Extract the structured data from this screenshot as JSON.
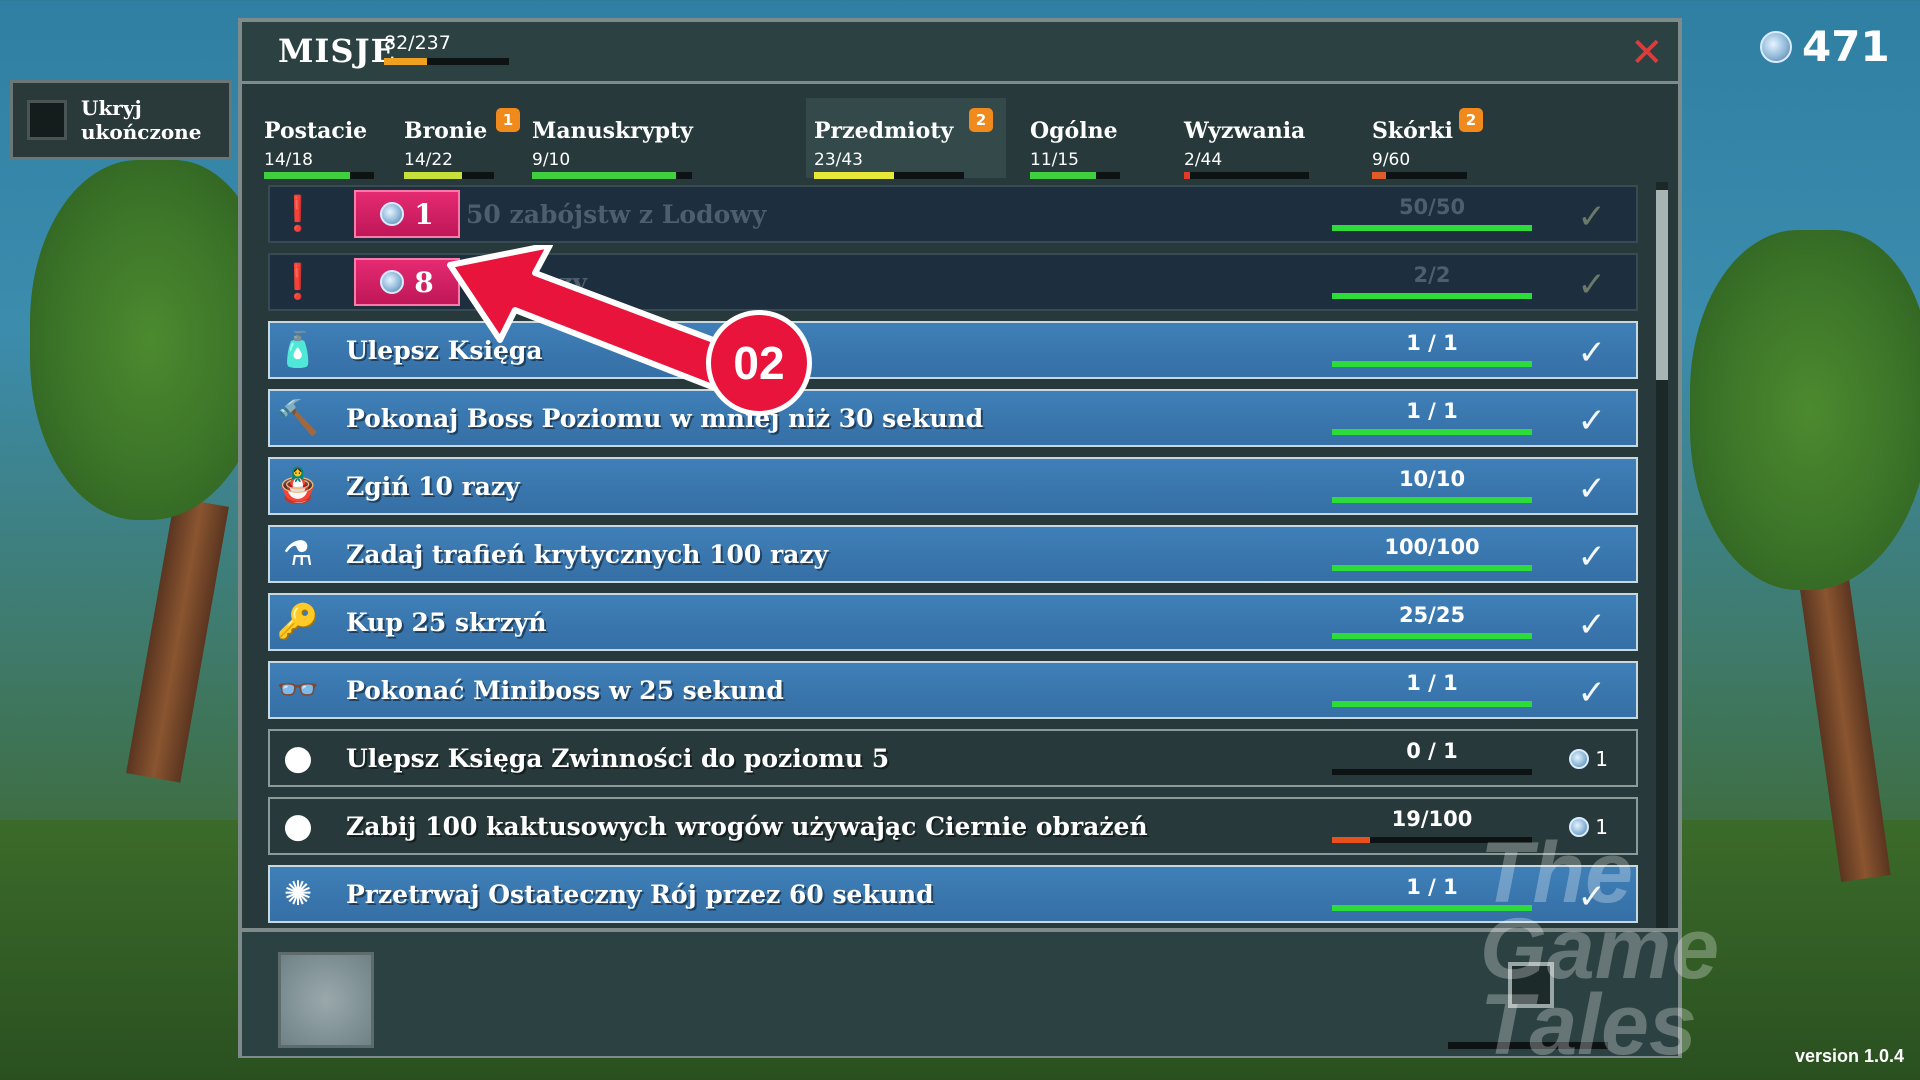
{
  "hide_completed": {
    "label_line1": "Ukryj",
    "label_line2": "ukończone"
  },
  "currency": {
    "value": "471",
    "icon": "gem-icon"
  },
  "panel": {
    "title": "MISJE",
    "overall_count": "82/237",
    "overall_progress": 0.346,
    "close_icon": "✕"
  },
  "tabs": [
    {
      "name": "Postacie",
      "count": "14/18",
      "progress": 0.78,
      "color": "#3fcf3f",
      "badge": ""
    },
    {
      "name": "Bronie",
      "count": "14/22",
      "progress": 0.64,
      "color": "#c8e03a",
      "badge": "1"
    },
    {
      "name": "Manuskrypty",
      "count": "9/10",
      "progress": 0.9,
      "color": "#3fcf3f",
      "badge": ""
    },
    {
      "name": "Przedmioty",
      "count": "23/43",
      "progress": 0.53,
      "color": "#e8e83a",
      "badge": "2"
    },
    {
      "name": "Ogólne",
      "count": "11/15",
      "progress": 0.73,
      "color": "#3fcf3f",
      "badge": ""
    },
    {
      "name": "Wyzwania",
      "count": "2/44",
      "progress": 0.05,
      "color": "#e03a2a",
      "badge": ""
    },
    {
      "name": "Skórki",
      "count": "9/60",
      "progress": 0.15,
      "color": "#e05a2a",
      "badge": "2"
    }
  ],
  "missions": [
    {
      "state": "claimable",
      "icon": "exclaim-icon",
      "text": "50 zabójstw z Lodowy",
      "count": "50/50",
      "progress": 1,
      "reward": "1"
    },
    {
      "state": "claimable",
      "icon": "exclaim-icon",
      "text": "ss 2 razy",
      "count": "2/2",
      "progress": 1,
      "reward": "8"
    },
    {
      "state": "done",
      "icon": "potion-can-icon",
      "text": "Ulepsz Księga",
      "count": "1 / 1",
      "progress": 1
    },
    {
      "state": "done",
      "icon": "hammer-icon",
      "text": "Pokonaj Boss Poziomu w mniej niż 30 sekund",
      "count": "1 / 1",
      "progress": 1
    },
    {
      "state": "done",
      "icon": "voodoo-doll-icon",
      "text": "Zgiń 10 razy",
      "count": "10/10",
      "progress": 1
    },
    {
      "state": "done",
      "icon": "flask-icon",
      "text": "Zadaj trafień krytycznych 100 razy",
      "count": "100/100",
      "progress": 1
    },
    {
      "state": "done",
      "icon": "key-icon",
      "text": "Kup 25 skrzyń",
      "count": "25/25",
      "progress": 1
    },
    {
      "state": "done",
      "icon": "glasses-icon",
      "text": "Pokonać Miniboss w 25 sekund",
      "count": "1 / 1",
      "progress": 1
    },
    {
      "state": "progress",
      "icon": "silhouette-icon",
      "text": "Ulepsz Księga Zwinności do poziomu 5",
      "count": "0 / 1",
      "progress": 0,
      "reward": "1"
    },
    {
      "state": "progress",
      "icon": "silhouette-icon",
      "text": "Zabij 100 kaktusowych wrogów używając Ciernie obrażeń",
      "count": "19/100",
      "progress": 0.19,
      "reward": "1"
    },
    {
      "state": "done",
      "icon": "swarm-icon",
      "text": "Przetrwaj Ostateczny Rój przez 60 sekund",
      "count": "1 / 1",
      "progress": 1
    }
  ],
  "annotation": {
    "label": "02",
    "color": "#e8143c"
  },
  "watermark": {
    "line1": "The",
    "line2": "Game",
    "line3": "Tales"
  },
  "version": "version 1.0.4",
  "colors": {
    "done_bar": "#2ddb3a",
    "progress_bar": "#e8501c",
    "claim": "#d81c64"
  }
}
